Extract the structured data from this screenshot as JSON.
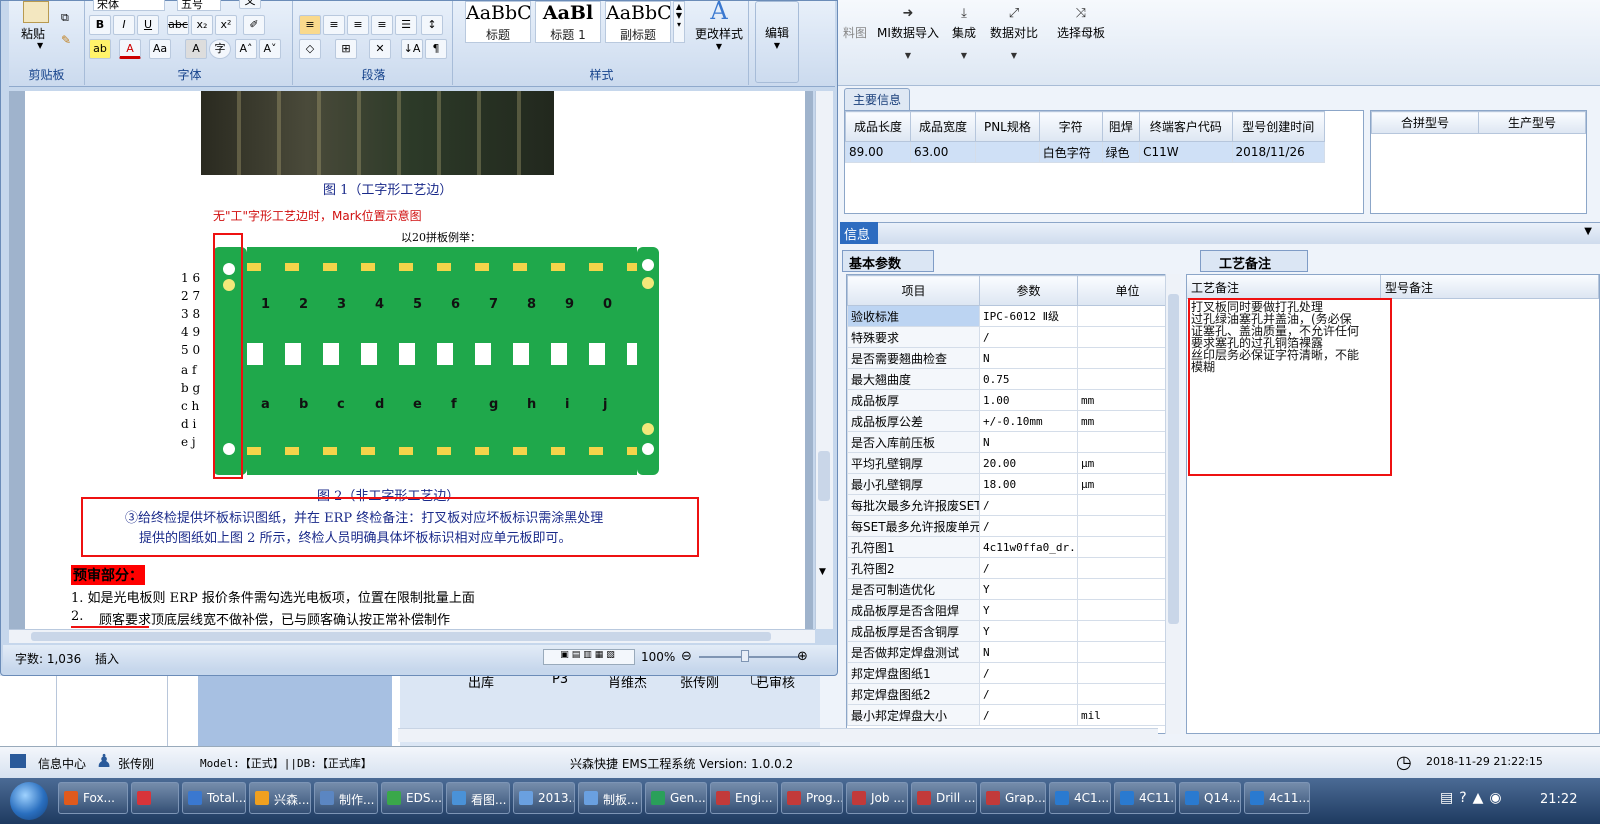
{
  "ems": {
    "toolbar": [
      {
        "label": "料图",
        "icon": ""
      },
      {
        "label": "MI数据导入",
        "icon": "import-icon"
      },
      {
        "label": "集成",
        "icon": "download-icon"
      },
      {
        "label": "数据对比",
        "icon": "compare-icon"
      },
      {
        "label": "选择母板",
        "icon": "shuffle-icon"
      }
    ],
    "main_tab": "主要信息",
    "main_grid": {
      "columns": [
        "成品长度",
        "成品宽度",
        "PNL规格",
        "字符",
        "阻焊",
        "终端客户代码",
        "型号创建时间"
      ],
      "rows": [
        [
          "89.00",
          "63.00",
          "",
          "白色字符",
          "绿色",
          "C11W",
          "2018/11/26"
        ]
      ]
    },
    "merge_grid": {
      "columns": [
        "合拼型号",
        "生产型号"
      ]
    },
    "info_tab": "信息",
    "params_tab": "基本参数",
    "params": {
      "columns": [
        "项目",
        "参数",
        "单位"
      ],
      "rows": [
        [
          "验收标准",
          "IPC-6012 Ⅱ级",
          ""
        ],
        [
          "特殊要求",
          "/",
          ""
        ],
        [
          "是否需要翘曲检查",
          "N",
          ""
        ],
        [
          "最大翘曲度",
          "0.75",
          ""
        ],
        [
          "成品板厚",
          "1.00",
          "mm"
        ],
        [
          "成品板厚公差",
          "+/-0.10mm",
          "mm"
        ],
        [
          "是否入库前压板",
          "N",
          ""
        ],
        [
          "平均孔壁铜厚",
          "20.00",
          "μm"
        ],
        [
          "最小孔壁铜厚",
          "18.00",
          "μm"
        ],
        [
          "每批次最多允许报废SET",
          "/",
          ""
        ],
        [
          "每SET最多允许报废单元",
          "/",
          ""
        ],
        [
          "孔符图1",
          "4c11w0ffa0_dr...",
          ""
        ],
        [
          "孔符图2",
          "/",
          ""
        ],
        [
          "是否可制造优化",
          "Y",
          ""
        ],
        [
          "成品板厚是否含阻焊",
          "Y",
          ""
        ],
        [
          "成品板厚是否含铜厚",
          "Y",
          ""
        ],
        [
          "是否做邦定焊盘测试",
          "N",
          ""
        ],
        [
          "邦定焊盘图纸1",
          "/",
          ""
        ],
        [
          "邦定焊盘图纸2",
          "/",
          ""
        ],
        [
          "最小邦定焊盘大小",
          "/",
          "mil"
        ]
      ]
    },
    "craft_tab": "工艺备注",
    "craft": {
      "col1": "工艺备注",
      "col2": "型号备注",
      "text": [
        "打叉板同时要做打孔处理",
        "过孔绿油塞孔并盖油，(务必保",
        "证塞孔、盖油质量，不允许任何",
        "要求塞孔的过孔铜箔裸露",
        "丝印层务必保证字符清晰，不能",
        "模糊"
      ]
    },
    "lower_row": [
      "出库",
      "P3",
      "肖维杰",
      "张传刚",
      "已审核"
    ],
    "status": {
      "info_center": "信息中心",
      "user": "张传刚",
      "model": "Model:【正式】||DB:【正式库】",
      "system": "兴森快捷 EMS工程系统 Version: 1.0.0.2",
      "datetime": "2018-11-29 21:22:15"
    }
  },
  "word": {
    "ribbon": {
      "paste": "粘贴",
      "clipboard": "剪贴板",
      "font_name": "宋体",
      "font_size": "五号",
      "font": "字体",
      "paragraph": "段落",
      "styles_label": "样式",
      "styles": [
        {
          "preview": "AaBbC",
          "name": "标题"
        },
        {
          "preview": "AaBl",
          "name": "标题 1"
        },
        {
          "preview": "AaBbC",
          "name": "副标题"
        }
      ],
      "change_styles": "更改样式",
      "edit": "编辑"
    },
    "doc": {
      "fig1_caption": "图 1（工字形工艺边）",
      "fig2_title": "无\"工\"字形工艺边时，Mark位置示意图",
      "fig2_subtitle": "以20拼板例举：",
      "left_digits": [
        "1 6",
        "2 7",
        "3 8",
        "4 9",
        "5 0"
      ],
      "left_letters": [
        "a f",
        "b g",
        "c h",
        "d i",
        "e j"
      ],
      "top_cells": [
        "1",
        "2",
        "3",
        "4",
        "5",
        "6",
        "7",
        "8",
        "9",
        "0"
      ],
      "bottom_cells": [
        "a",
        "b",
        "c",
        "d",
        "e",
        "f",
        "g",
        "h",
        "i",
        "j"
      ],
      "fig2_caption": "图 2（非工字形工艺边）",
      "note_line1": "③给终检提供坏板标识图纸，并在 ERP 终检备注：打叉板对应坏板标识需涂黑处理",
      "note_line2": "提供的图纸如上图 2 所示，终检人员明确具体坏板标识相对应单元板即可。",
      "section": "预审部分：",
      "item1": "1.   如是光电板则 ERP 报价条件需勾选光电板项，位置在限制批量上面",
      "item2_num": "2.",
      "item2": "顾客要求顶底层线宽不做补偿，已与顾客确认按正常补偿制作"
    },
    "status": {
      "words": "字数: 1,036",
      "mode": "插入",
      "zoom": "100%"
    }
  },
  "taskbar": {
    "items": [
      {
        "label": "Fox...",
        "color": "#e05a1c"
      },
      {
        "label": "",
        "color": "#d8343a"
      },
      {
        "label": "Total...",
        "color": "#3a78d0"
      },
      {
        "label": "兴森...",
        "color": "#f0a020"
      },
      {
        "label": "制作...",
        "color": "#5b86c2"
      },
      {
        "label": "EDS...",
        "color": "#3aa84a"
      },
      {
        "label": "看图...",
        "color": "#4a92d8"
      },
      {
        "label": "2013...",
        "color": "#6aa0e0"
      },
      {
        "label": "制板...",
        "color": "#6aa0e0"
      },
      {
        "label": "Gen...",
        "color": "#2aa05a"
      },
      {
        "label": "Engi...",
        "color": "#c23a3a"
      },
      {
        "label": "Prog...",
        "color": "#c23a3a"
      },
      {
        "label": "Job ...",
        "color": "#c23a3a"
      },
      {
        "label": "Drill ...",
        "color": "#c23a3a"
      },
      {
        "label": "Grap...",
        "color": "#c23a3a"
      },
      {
        "label": "4C1...",
        "color": "#2a7ad0"
      },
      {
        "label": "4C11...",
        "color": "#2a7ad0"
      },
      {
        "label": "Q14...",
        "color": "#2a7ad0"
      },
      {
        "label": "4c11...",
        "color": "#2a7ad0"
      }
    ],
    "clock": "21:22"
  }
}
